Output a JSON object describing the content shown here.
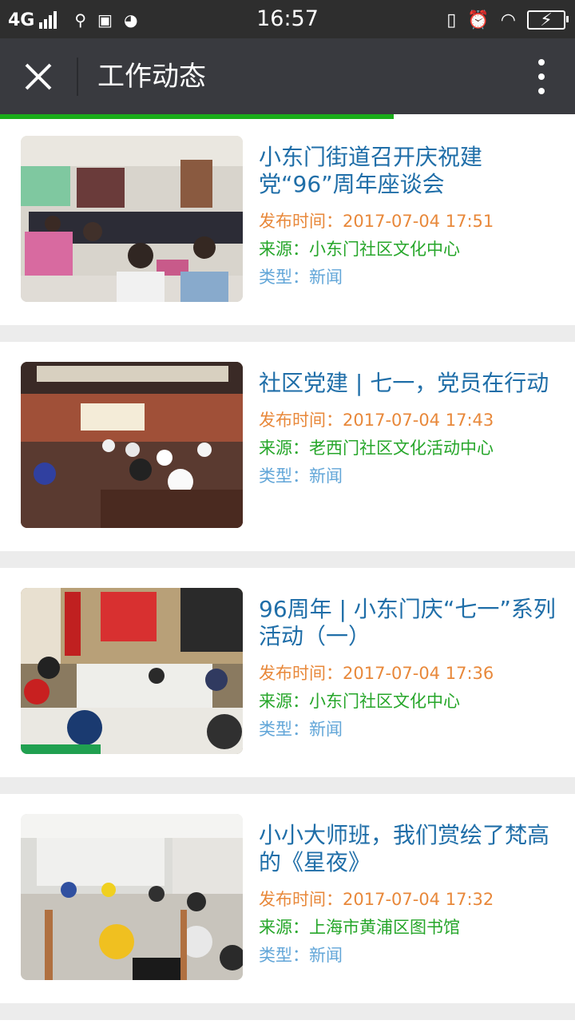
{
  "status_bar": {
    "network": "4G",
    "time": "16:57",
    "battery": "⚡"
  },
  "header": {
    "title": "工作动态",
    "progress": 0.685
  },
  "labels": {
    "time": "发布时间：",
    "source": "来源：",
    "type": "类型："
  },
  "articles": [
    {
      "title": "小东门街道召开庆祝建党“96”周年座谈会",
      "time": "2017-07-04 17:51",
      "source": "小东门社区文化中心",
      "type": "新闻"
    },
    {
      "title": "社区党建 | 七一，党员在行动",
      "time": "2017-07-04 17:43",
      "source": "老西门社区文化活动中心",
      "type": "新闻"
    },
    {
      "title": "96周年 | 小东门庆“七一”系列活动（一）",
      "time": "2017-07-04 17:36",
      "source": "小东门社区文化中心",
      "type": "新闻"
    },
    {
      "title": "小小大师班，我们赏绘了梵高的《星夜》",
      "time": "2017-07-04 17:32",
      "source": "上海市黄浦区图书馆",
      "type": "新闻"
    }
  ]
}
